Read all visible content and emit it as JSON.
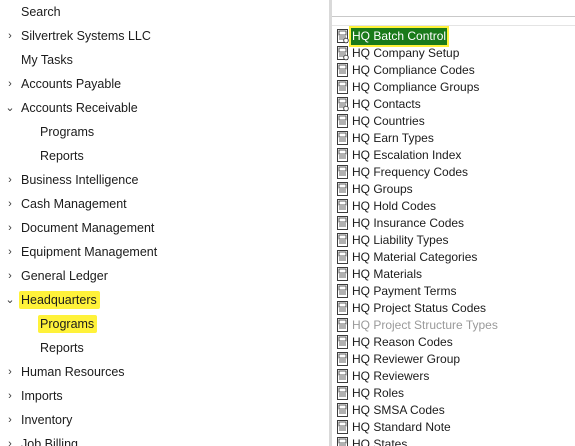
{
  "nav": {
    "items": [
      {
        "label": "Search",
        "chevron": "",
        "child": false,
        "highlight": false
      },
      {
        "label": "Silvertrek Systems LLC",
        "chevron": "›",
        "child": false,
        "highlight": false
      },
      {
        "label": "My Tasks",
        "chevron": "",
        "child": false,
        "highlight": false
      },
      {
        "label": "Accounts Payable",
        "chevron": "›",
        "child": false,
        "highlight": false
      },
      {
        "label": "Accounts Receivable",
        "chevron": "⌄",
        "child": false,
        "highlight": false
      },
      {
        "label": "Programs",
        "chevron": "",
        "child": true,
        "highlight": false
      },
      {
        "label": "Reports",
        "chevron": "",
        "child": true,
        "highlight": false
      },
      {
        "label": "Business Intelligence",
        "chevron": "›",
        "child": false,
        "highlight": false
      },
      {
        "label": "Cash Management",
        "chevron": "›",
        "child": false,
        "highlight": false
      },
      {
        "label": "Document Management",
        "chevron": "›",
        "child": false,
        "highlight": false
      },
      {
        "label": "Equipment Management",
        "chevron": "›",
        "child": false,
        "highlight": false
      },
      {
        "label": "General Ledger",
        "chevron": "›",
        "child": false,
        "highlight": false
      },
      {
        "label": "Headquarters",
        "chevron": "⌄",
        "child": false,
        "highlight": true
      },
      {
        "label": "Programs",
        "chevron": "",
        "child": true,
        "highlight": true
      },
      {
        "label": "Reports",
        "chevron": "",
        "child": true,
        "highlight": false
      },
      {
        "label": "Human Resources",
        "chevron": "›",
        "child": false,
        "highlight": false
      },
      {
        "label": "Imports",
        "chevron": "›",
        "child": false,
        "highlight": false
      },
      {
        "label": "Inventory",
        "chevron": "›",
        "child": false,
        "highlight": false
      },
      {
        "label": "Job Billing",
        "chevron": "›",
        "child": false,
        "highlight": false
      }
    ]
  },
  "programs": {
    "icon": "form-icon",
    "selected_color": "#1a7a1a",
    "highlight_color": "#fff23a",
    "items": [
      {
        "label": "HQ Batch Control",
        "selected": true,
        "disabled": false
      },
      {
        "label": "HQ Company Setup",
        "selected": false,
        "disabled": false
      },
      {
        "label": "HQ Compliance Codes",
        "selected": false,
        "disabled": false
      },
      {
        "label": "HQ Compliance Groups",
        "selected": false,
        "disabled": false
      },
      {
        "label": "HQ Contacts",
        "selected": false,
        "disabled": false
      },
      {
        "label": "HQ Countries",
        "selected": false,
        "disabled": false
      },
      {
        "label": "HQ Earn Types",
        "selected": false,
        "disabled": false
      },
      {
        "label": "HQ Escalation Index",
        "selected": false,
        "disabled": false
      },
      {
        "label": "HQ Frequency Codes",
        "selected": false,
        "disabled": false
      },
      {
        "label": "HQ Groups",
        "selected": false,
        "disabled": false
      },
      {
        "label": "HQ Hold Codes",
        "selected": false,
        "disabled": false
      },
      {
        "label": "HQ Insurance Codes",
        "selected": false,
        "disabled": false
      },
      {
        "label": "HQ Liability Types",
        "selected": false,
        "disabled": false
      },
      {
        "label": "HQ Material Categories",
        "selected": false,
        "disabled": false
      },
      {
        "label": "HQ Materials",
        "selected": false,
        "disabled": false
      },
      {
        "label": "HQ Payment Terms",
        "selected": false,
        "disabled": false
      },
      {
        "label": "HQ Project Status Codes",
        "selected": false,
        "disabled": false
      },
      {
        "label": "HQ Project Structure Types",
        "selected": false,
        "disabled": true
      },
      {
        "label": "HQ Reason Codes",
        "selected": false,
        "disabled": false
      },
      {
        "label": "HQ Reviewer Group",
        "selected": false,
        "disabled": false
      },
      {
        "label": "HQ Reviewers",
        "selected": false,
        "disabled": false
      },
      {
        "label": "HQ Roles",
        "selected": false,
        "disabled": false
      },
      {
        "label": "HQ SMSA Codes",
        "selected": false,
        "disabled": false
      },
      {
        "label": "HQ Standard Note",
        "selected": false,
        "disabled": false
      },
      {
        "label": "HQ States",
        "selected": false,
        "disabled": false
      }
    ]
  }
}
